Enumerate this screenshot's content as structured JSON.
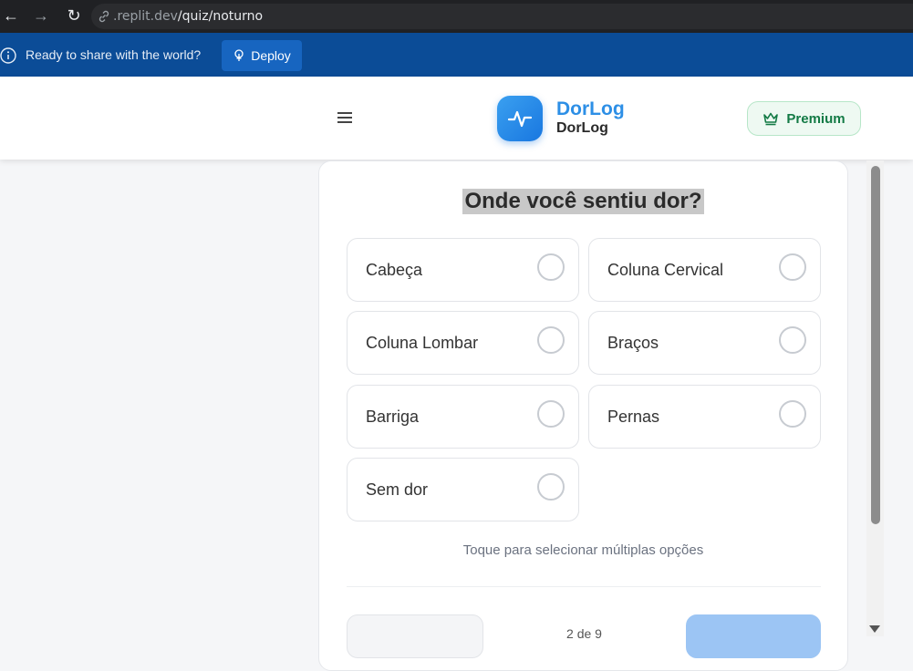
{
  "browser": {
    "url_domain": ".replit.dev",
    "url_path": "/quiz/noturno",
    "back_glyph": "←",
    "forward_glyph": "→",
    "reload_glyph": "↻"
  },
  "replit_banner": {
    "message": "Ready to share with the world?",
    "deploy_label": "Deploy",
    "background": "#0b4c97"
  },
  "header": {
    "brand_title": "DorLog",
    "brand_subtitle": "DorLog",
    "premium_label": "Premium",
    "accent_color": "#2d8fe6",
    "premium_color": "#137a45"
  },
  "quiz": {
    "question": "Onde você sentiu dor?",
    "options": [
      {
        "label": "Cabeça",
        "selected": false
      },
      {
        "label": "Coluna Cervical",
        "selected": false
      },
      {
        "label": "Coluna Lombar",
        "selected": false
      },
      {
        "label": "Braços",
        "selected": false
      },
      {
        "label": "Barriga",
        "selected": false
      },
      {
        "label": "Pernas",
        "selected": false
      },
      {
        "label": "Sem dor",
        "selected": false
      }
    ],
    "hint": "Toque para selecionar múltiplas opções",
    "step_text": "2 de 9"
  },
  "icons": {
    "info": "info-icon",
    "deploy": "deploy-icon",
    "menu": "hamburger-menu-icon",
    "logo": "pulse-icon",
    "premium": "crown-icon",
    "link": "link-icon"
  }
}
